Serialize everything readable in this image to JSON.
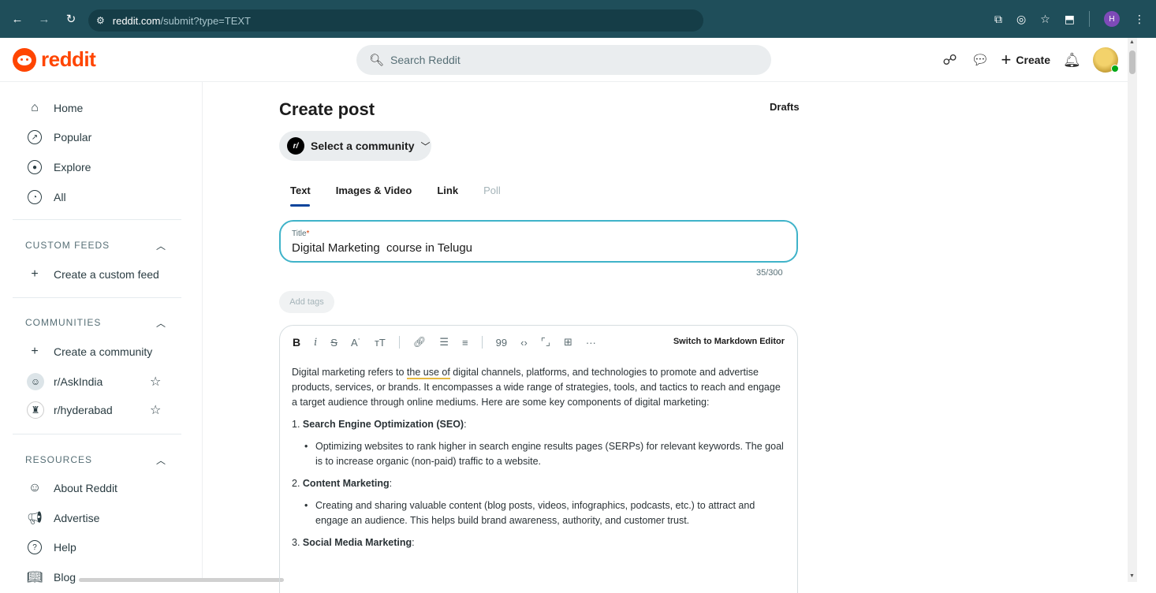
{
  "browser": {
    "url_host": "reddit.com",
    "url_path": "/submit?type=TEXT",
    "profile_initial": "H"
  },
  "header": {
    "logo_text": "reddit",
    "search_placeholder": "Search Reddit",
    "create_label": "Create"
  },
  "sidebar": {
    "nav": [
      {
        "label": "Home",
        "icon": "home-icon"
      },
      {
        "label": "Popular",
        "icon": "popular-icon"
      },
      {
        "label": "Explore",
        "icon": "explore-icon"
      },
      {
        "label": "All",
        "icon": "all-icon"
      }
    ],
    "custom_feeds_heading": "CUSTOM FEEDS",
    "create_custom_feed": "Create a custom feed",
    "communities_heading": "COMMUNITIES",
    "create_community": "Create a community",
    "communities": [
      "r/AskIndia",
      "r/hyderabad"
    ],
    "resources_heading": "RESOURCES",
    "resources": [
      "About Reddit",
      "Advertise",
      "Help",
      "Blog"
    ]
  },
  "main": {
    "page_title": "Create post",
    "drafts_label": "Drafts",
    "community_select": "Select a community",
    "community_logo": "r/",
    "tabs": [
      "Text",
      "Images & Video",
      "Link",
      "Poll"
    ],
    "title_label": "Title",
    "title_required": "*",
    "title_value": "Digital Marketing  course in Telugu",
    "title_counter": "35/300",
    "add_tags": "Add tags",
    "markdown_switch": "Switch to Markdown Editor",
    "body": {
      "intro_pre": "Digital marketing refers to ",
      "intro_underlined": "the use of",
      "intro_post": " digital channels, platforms, and technologies to promote and advertise products, services, or brands. It encompasses a wide range of strategies, tools, and tactics to reach and engage a target audience through online mediums. Here are some key components of digital marketing:",
      "sections": [
        {
          "num": "1. ",
          "heading": "Search Engine Optimization (SEO)",
          "bullet": "Optimizing websites to rank higher in search engine results pages (SERPs) for relevant keywords. The goal is to increase organic (non-paid) traffic to a website."
        },
        {
          "num": "2. ",
          "heading": "Content Marketing",
          "bullet": "Creating and sharing valuable content (blog posts, videos, infographics, podcasts, etc.) to attract and engage an audience. This helps build brand awareness, authority, and customer trust."
        },
        {
          "num": "3. ",
          "heading": "Social Media Marketing",
          "bullet": ""
        }
      ]
    }
  }
}
